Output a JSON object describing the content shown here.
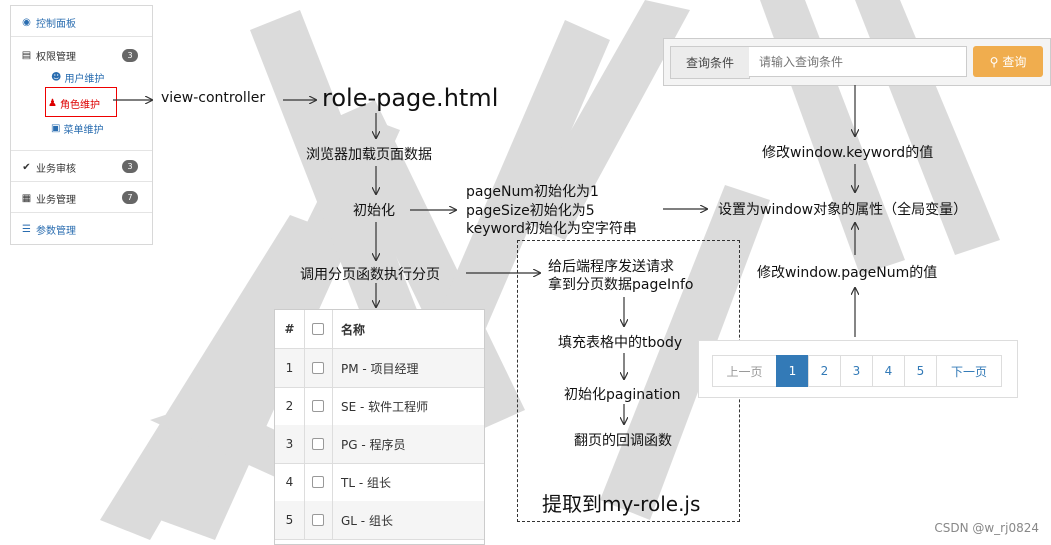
{
  "sidebar": {
    "dashboard": "控制面板",
    "permissions": "权限管理",
    "permissions_badge": "3",
    "user_maintenance": "用户维护",
    "role_maintenance": "角色维护",
    "menu_maintenance": "菜单维护",
    "business_review": "业务审核",
    "business_review_badge": "3",
    "business_management": "业务管理",
    "business_management_badge": "7",
    "parameter_management": "参数管理"
  },
  "flow": {
    "view_controller": "view-controller",
    "role_page": "role-page.html",
    "browser_load": "浏览器加载页面数据",
    "init": "初始化",
    "init_vars": {
      "page_num": "pageNum初始化为1",
      "page_size": "pageSize初始化为5",
      "keyword": "keyword初始化为空字符串"
    },
    "set_global": "设置为window对象的属性（全局变量）",
    "call_paging": "调用分页函数执行分页",
    "send_request": "给后端程序发送请求",
    "get_page_info": "拿到分页数据pageInfo",
    "fill_tbody": "填充表格中的tbody",
    "init_pagination": "初始化pagination",
    "page_callback": "翻页的回调函数",
    "extract": "提取到my-role.js",
    "modify_keyword": "修改window.keyword的值",
    "modify_page_num": "修改window.pageNum的值"
  },
  "search": {
    "label": "查询条件",
    "placeholder": "请输入查询条件",
    "button": "查询"
  },
  "table": {
    "headers": [
      "#",
      "名称"
    ],
    "rows": [
      {
        "num": "1",
        "name": "PM - 项目经理"
      },
      {
        "num": "2",
        "name": "SE - 软件工程师"
      },
      {
        "num": "3",
        "name": "PG - 程序员"
      },
      {
        "num": "4",
        "name": "TL - 组长"
      },
      {
        "num": "5",
        "name": "GL - 组长"
      }
    ]
  },
  "pagination": {
    "prev": "上一页",
    "pages": [
      "1",
      "2",
      "3",
      "4",
      "5"
    ],
    "next": "下一页",
    "current": "1"
  },
  "credit": "CSDN @w_rj0824",
  "colors": {
    "accent_blue": "#337ab7",
    "search_orange": "#f0ad4e",
    "highlight_red": "#e00000"
  }
}
